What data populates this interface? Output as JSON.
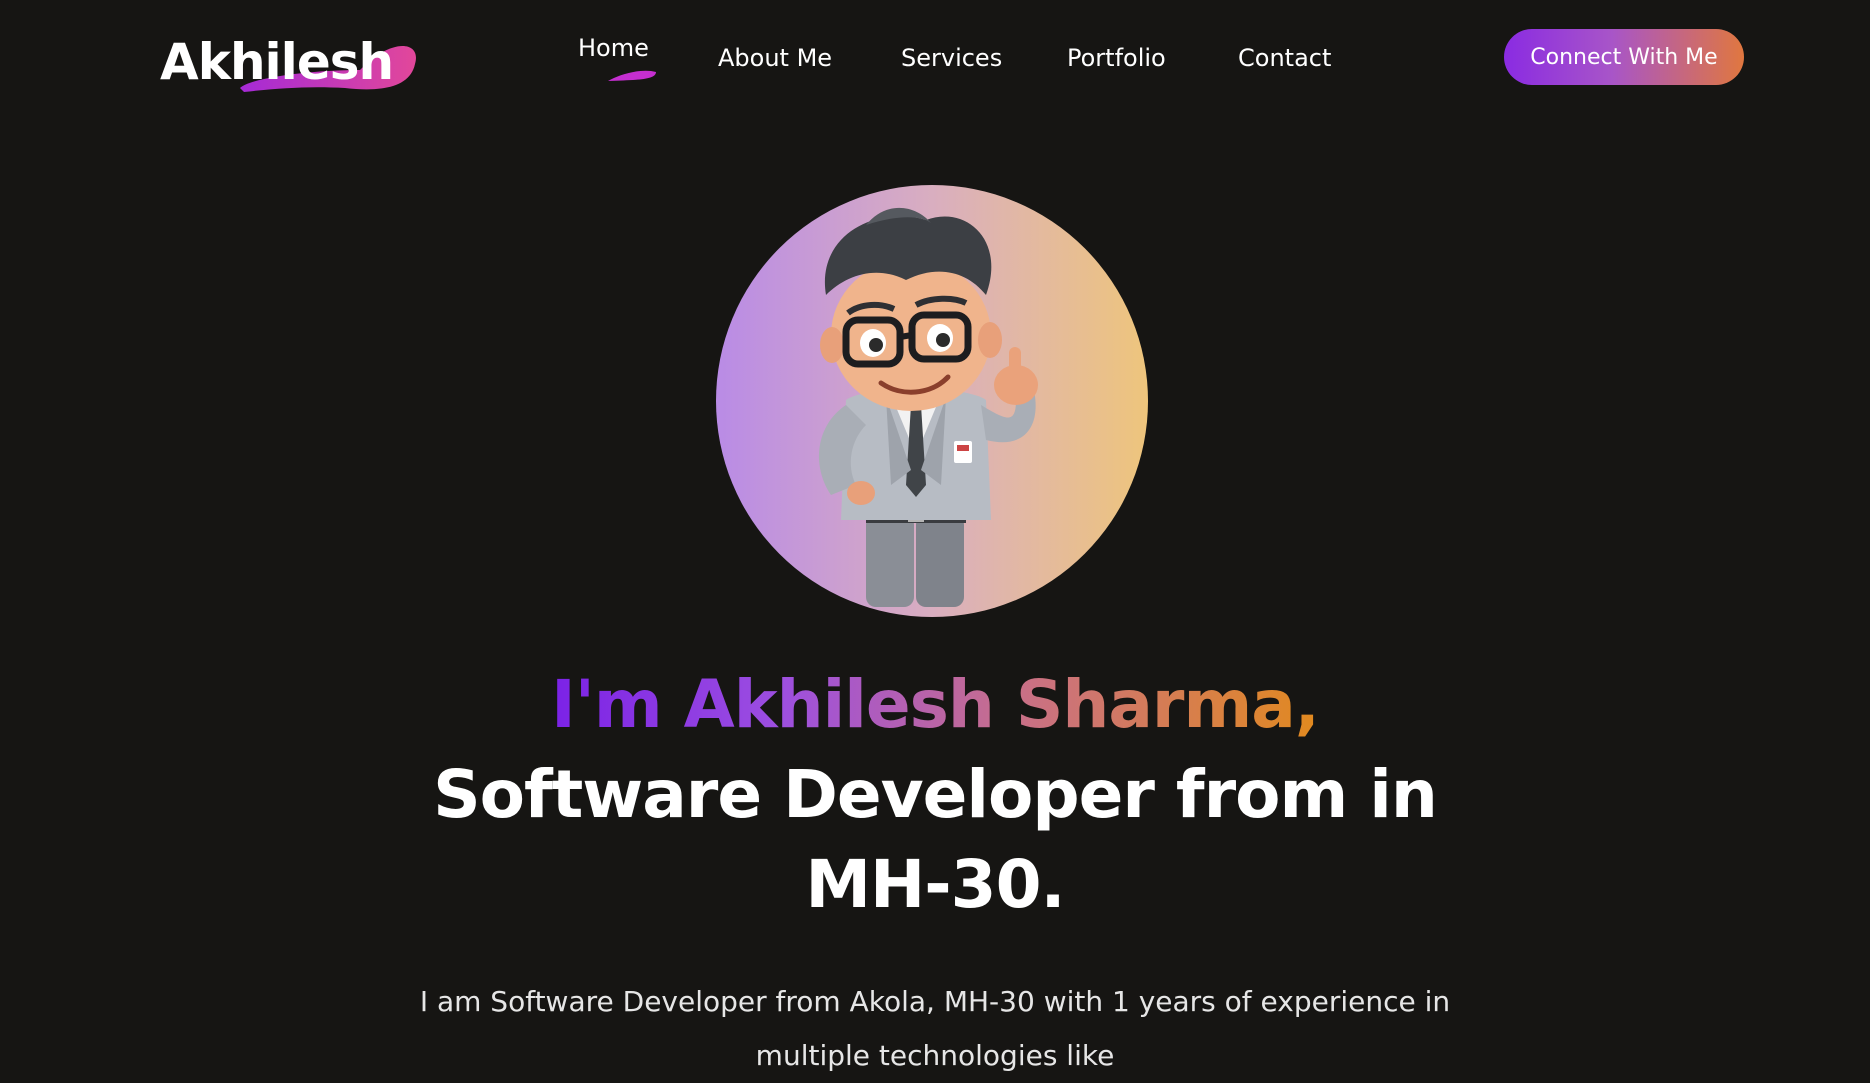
{
  "brand": {
    "logo_text": "Akhilesh",
    "accent_gradient": [
      "#8a2be2",
      "#e0773f"
    ],
    "logo_swoosh_color": "#c52fd0"
  },
  "nav": {
    "items": [
      {
        "label": "Home",
        "active": true
      },
      {
        "label": "About Me",
        "active": false
      },
      {
        "label": "Services",
        "active": false
      },
      {
        "label": "Portfolio",
        "active": false
      },
      {
        "label": "Contact",
        "active": false
      }
    ],
    "cta_label": "Connect With Me"
  },
  "hero": {
    "avatar_icon": "cartoon-developer-thumbs-up",
    "name_line": "I'm Akhilesh Sharma,",
    "title_line_1": "Software Developer from in",
    "title_line_2": "MH-30.",
    "description_line_1": "I am Software Developer from Akola, MH-30 with 1 years of experience in",
    "description_line_2": "multiple technologies like"
  },
  "colors": {
    "background": "#161513",
    "text": "#ffffff",
    "name_gradient": [
      "#7b22e6",
      "#e28a1e"
    ]
  }
}
